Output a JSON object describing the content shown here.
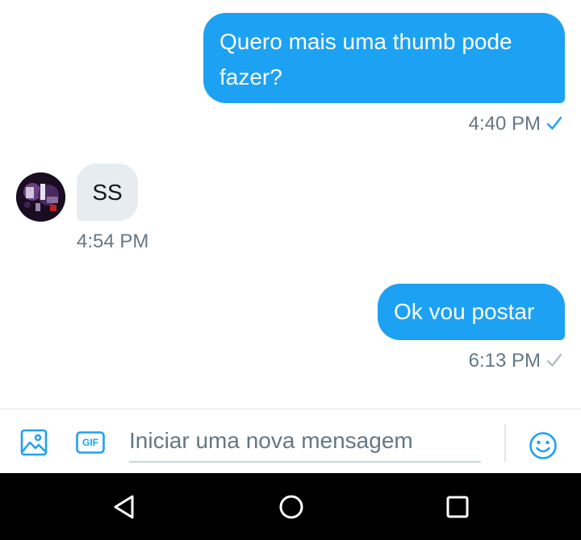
{
  "messages": [
    {
      "direction": "outgoing",
      "text": "Quero mais uma thumb pode fazer?",
      "time": "4:40 PM",
      "status": "read"
    },
    {
      "direction": "incoming",
      "text": "SS",
      "time": "4:54 PM"
    },
    {
      "direction": "outgoing",
      "text": "Ok vou postar",
      "time": "6:13 PM",
      "status": "sent"
    }
  ],
  "composer": {
    "placeholder": "Iniciar uma nova mensagem",
    "value": "",
    "media_icon": "image-icon",
    "gif_label": "GIF",
    "emoji_icon": "emoji-icon"
  },
  "navbar": {
    "buttons": [
      "back",
      "home",
      "recent-apps"
    ]
  },
  "colors": {
    "accent": "#1da1f2",
    "incoming_bubble": "#e6ecf0",
    "secondary_text": "#657786",
    "sent_check": "#aab8c2",
    "read_check": "#1da1f2"
  }
}
